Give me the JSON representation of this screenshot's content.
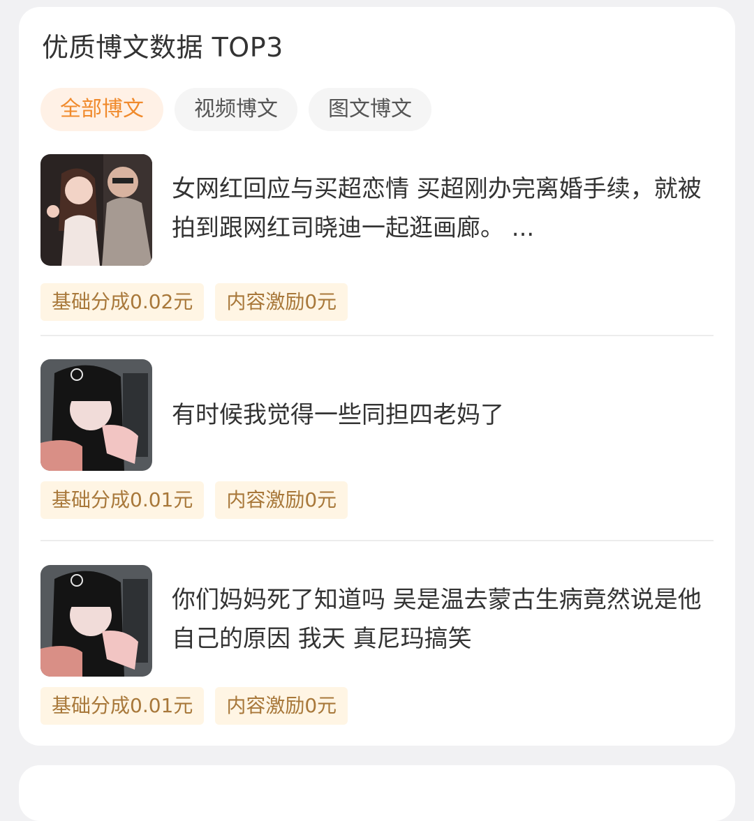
{
  "section": {
    "title": "优质博文数据 TOP3"
  },
  "tabs": [
    {
      "label": "全部博文",
      "active": true
    },
    {
      "label": "视频博文",
      "active": false
    },
    {
      "label": "图文博文",
      "active": false
    }
  ],
  "posts": [
    {
      "text": "女网红回应与买超恋情 买超刚办完离婚手续，就被拍到跟网红司晓迪一起逛画廊。 ...",
      "base_share": "基础分成0.02元",
      "content_incentive": "内容激励0元"
    },
    {
      "text": "有时候我觉得一些同担四老妈了",
      "base_share": "基础分成0.01元",
      "content_incentive": "内容激励0元"
    },
    {
      "text": "你们妈妈死了知道吗 吴是温去蒙古生病竟然说是他自己的原因 我天 真尼玛搞笑",
      "base_share": "基础分成0.01元",
      "content_incentive": "内容激励0元"
    }
  ],
  "colors": {
    "accent": "#f08a2c",
    "tag_bg": "#fff5e4",
    "tag_text": "#a8783a"
  }
}
